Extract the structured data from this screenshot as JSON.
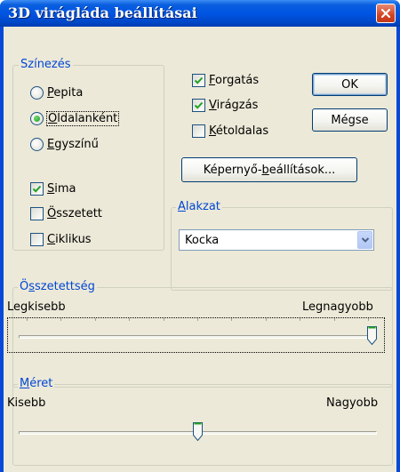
{
  "window": {
    "title": "3D virágláda beállításai"
  },
  "coloring": {
    "legend": "Színezés",
    "options": [
      {
        "pre": "",
        "key": "P",
        "post": "epita",
        "selected": false
      },
      {
        "pre": "",
        "key": "O",
        "post": "ldalanként",
        "selected": true
      },
      {
        "pre": "",
        "key": "E",
        "post": "gyszínű",
        "selected": false
      }
    ],
    "checks": [
      {
        "pre": "",
        "key": "S",
        "post": "ima",
        "checked": true
      },
      {
        "pre": "",
        "key": "Ö",
        "post": "sszetett",
        "checked": false
      },
      {
        "pre": "",
        "key": "C",
        "post": "iklikus",
        "checked": false
      }
    ]
  },
  "options": [
    {
      "pre": "",
      "key": "F",
      "post": "orgatás",
      "checked": true
    },
    {
      "pre": "",
      "key": "V",
      "post": "irágzás",
      "checked": true
    },
    {
      "pre": "",
      "key": "K",
      "post": "étoldalas",
      "checked": false
    }
  ],
  "buttons": {
    "ok": "OK",
    "cancel": "Mégse",
    "screen_pre": "Képernyő-",
    "screen_key": "b",
    "screen_post": "eállítások..."
  },
  "shape": {
    "legend_key": "A",
    "legend_rest": "lakzat",
    "selected": "Kocka"
  },
  "complexity": {
    "legend_pre": "Ö",
    "legend_key": "s",
    "legend_post": "szetettség",
    "min_label": "Legkisebb",
    "max_label": "Legnagyobb",
    "value": 1.0
  },
  "size": {
    "legend_key": "M",
    "legend_rest": "éret",
    "min_label": "Kisebb",
    "max_label": "Nagyobb",
    "value": 0.5
  },
  "colors": {
    "title_bar": "#0054e3",
    "legend": "#0046d5",
    "check": "#21a121",
    "close": "#d44421"
  },
  "icons": {
    "close": "close-icon",
    "dropdown": "chevron-down-icon"
  }
}
